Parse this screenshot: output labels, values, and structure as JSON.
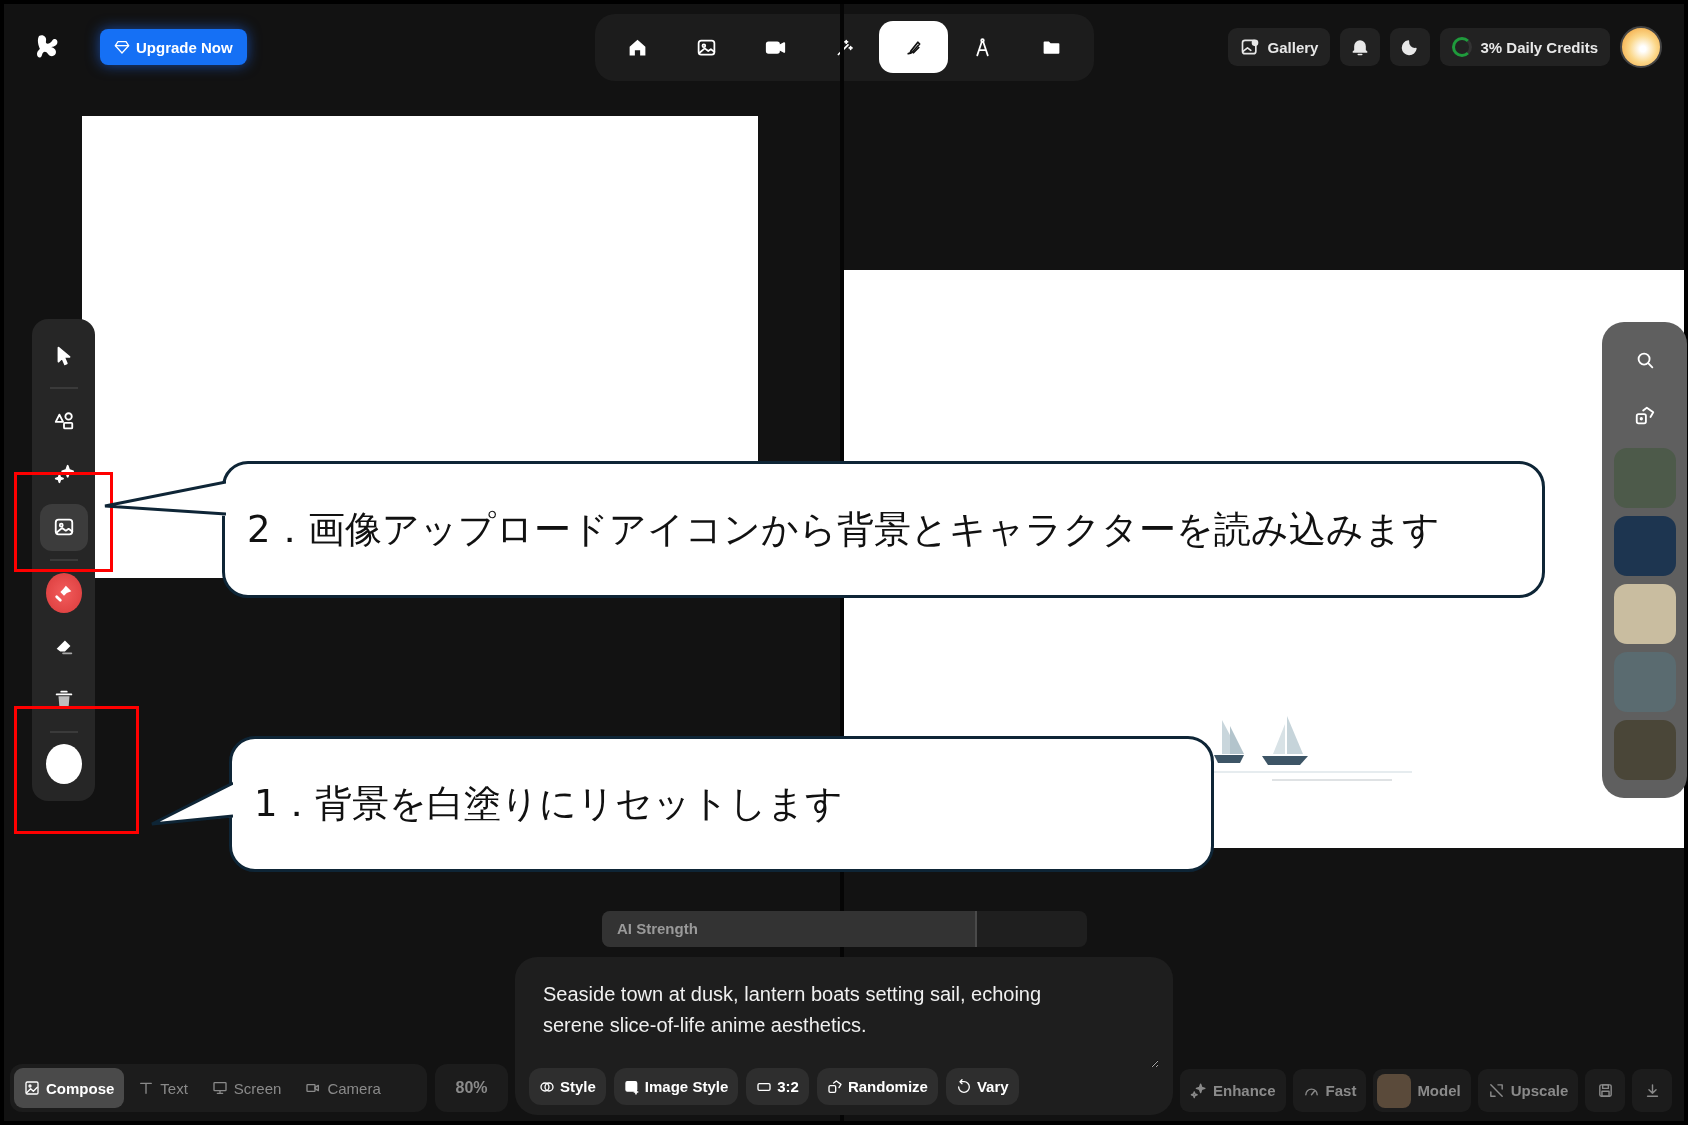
{
  "header": {
    "upgrade_label": "Upgrade Now",
    "gallery_label": "Gallery",
    "credits_label": "3% Daily Credits"
  },
  "nav_tabs": [
    {
      "kind": "home",
      "selected": false
    },
    {
      "kind": "image",
      "selected": false
    },
    {
      "kind": "video",
      "selected": false
    },
    {
      "kind": "magic",
      "selected": false
    },
    {
      "kind": "brush",
      "selected": true
    },
    {
      "kind": "compass",
      "selected": false
    },
    {
      "kind": "folder",
      "selected": false
    }
  ],
  "tool_rail": [
    {
      "kind": "pointer",
      "selected": false
    },
    {
      "kind": "shapes",
      "selected": false
    },
    {
      "kind": "sparkle",
      "selected": false
    },
    {
      "kind": "image",
      "selected": true
    },
    {
      "kind": "stamp",
      "selected": false
    },
    {
      "kind": "eraser",
      "selected": false
    },
    {
      "kind": "trash",
      "selected": false
    },
    {
      "kind": "reset",
      "selected": false
    }
  ],
  "callouts": [
    {
      "text": "2．画像アップロードアイコンから背景とキャラクターを読み込みます"
    },
    {
      "text": "1．背景を白塗りにリセットします"
    }
  ],
  "ai_strength": {
    "label": "AI Strength",
    "level": 0.77
  },
  "prompt": {
    "value": "Seaside town at dusk, lantern boats setting sail, echoing serene slice-of-life anime aesthetics.",
    "chips": [
      {
        "kind": "style",
        "label": "Style"
      },
      {
        "kind": "image_style",
        "label": "Image Style"
      },
      {
        "kind": "ratio",
        "label": "3:2"
      },
      {
        "kind": "randomize",
        "label": "Randomize"
      },
      {
        "kind": "vary",
        "label": "Vary"
      }
    ]
  },
  "mode_tabs": [
    {
      "kind": "compose",
      "label": "Compose",
      "selected": true
    },
    {
      "kind": "text",
      "label": "Text",
      "selected": false
    },
    {
      "kind": "screen",
      "label": "Screen",
      "selected": false
    },
    {
      "kind": "camera",
      "label": "Camera",
      "selected": false
    }
  ],
  "zoom_level": "80%",
  "actions": [
    {
      "kind": "enhance",
      "label": "Enhance"
    },
    {
      "kind": "fast",
      "label": "Fast"
    },
    {
      "kind": "model",
      "label": "Model"
    },
    {
      "kind": "upscale",
      "label": "Upscale"
    },
    {
      "kind": "save"
    },
    {
      "kind": "download"
    }
  ]
}
